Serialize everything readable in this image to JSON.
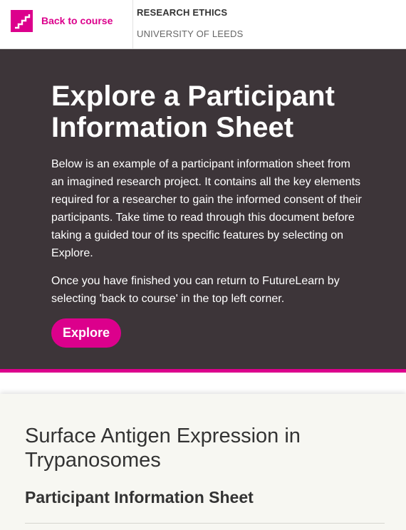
{
  "header": {
    "back_label": "Back to course",
    "course_title": "RESEARCH ETHICS",
    "course_org": "UNIVERSITY OF LEEDS",
    "logo_icon": "futurelearn-logo-icon"
  },
  "hero": {
    "title": "Explore a Participant Information Sheet",
    "intro": "Below is an example of a participant information sheet from an imagined research project. It contains all the key elements required for a researcher to gain the informed consent of their participants. Take time to read through this document before taking a guided tour of its specific features by selecting on Explore.",
    "return_text": "Once you have finished you can return to FutureLearn by selecting 'back to course' in the top left corner.",
    "explore_label": "Explore"
  },
  "document": {
    "title": "Surface Antigen Expression in Trypanosomes",
    "subtitle": "Participant Information Sheet"
  },
  "colors": {
    "accent": "#dc008c",
    "hero_bg": "#3d3539",
    "page_bg": "#f7f7f2"
  }
}
